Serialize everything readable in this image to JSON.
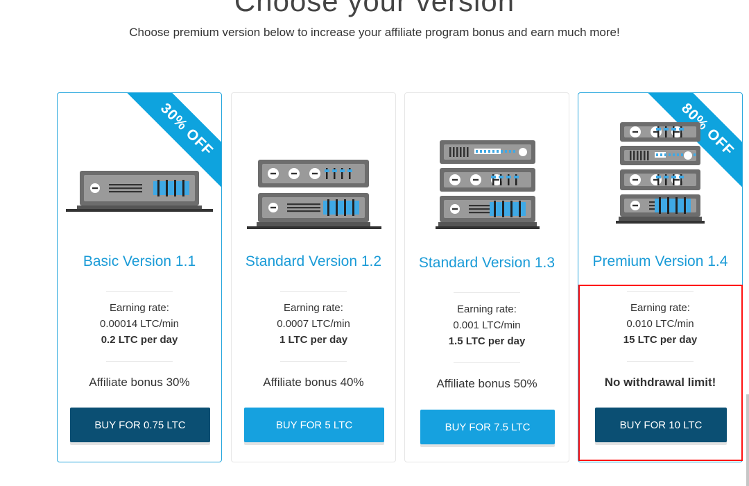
{
  "header": {
    "title": "Choose your version",
    "subtitle": "Choose premium version below to increase your affiliate program bonus and earn much more!"
  },
  "plans": [
    {
      "name": "Basic Version 1.1",
      "ribbon": "30% OFF",
      "rate_label": "Earning rate:",
      "rate_min": "0.00014 LTC/min",
      "rate_day": "0.2 LTC per day",
      "bonus": "Affiliate bonus 30%",
      "button": "BUY FOR 0.75 LTC",
      "button_style": "dark",
      "servers": 1
    },
    {
      "name": "Standard Version 1.2",
      "ribbon": "",
      "rate_label": "Earning rate:",
      "rate_min": "0.0007 LTC/min",
      "rate_day": "1 LTC per day",
      "bonus": "Affiliate bonus 40%",
      "button": "BUY FOR 5 LTC",
      "button_style": "light",
      "servers": 2
    },
    {
      "name": "Standard Version 1.3",
      "ribbon": "",
      "rate_label": "Earning rate:",
      "rate_min": "0.001 LTC/min",
      "rate_day": "1.5 LTC per day",
      "bonus": "Affiliate bonus 50%",
      "button": "BUY FOR 7.5 LTC",
      "button_style": "light",
      "servers": 3
    },
    {
      "name": "Premium Version 1.4",
      "ribbon": "80% OFF",
      "rate_label": "Earning rate:",
      "rate_min": "0.010 LTC/min",
      "rate_day": "15 LTC per day",
      "bonus": "No withdrawal limit!",
      "button": "BUY FOR 10 LTC",
      "button_style": "dark",
      "servers": 4
    }
  ],
  "colors": {
    "accent": "#1a9bd7",
    "ribbon": "#0ea3de",
    "button_dark": "#0b4f73",
    "button_light": "#16a1df",
    "highlight": "#ff1010",
    "server_body": "#6d6d6d",
    "server_face": "#9a9a9a",
    "server_led": "#3fa9e5"
  }
}
